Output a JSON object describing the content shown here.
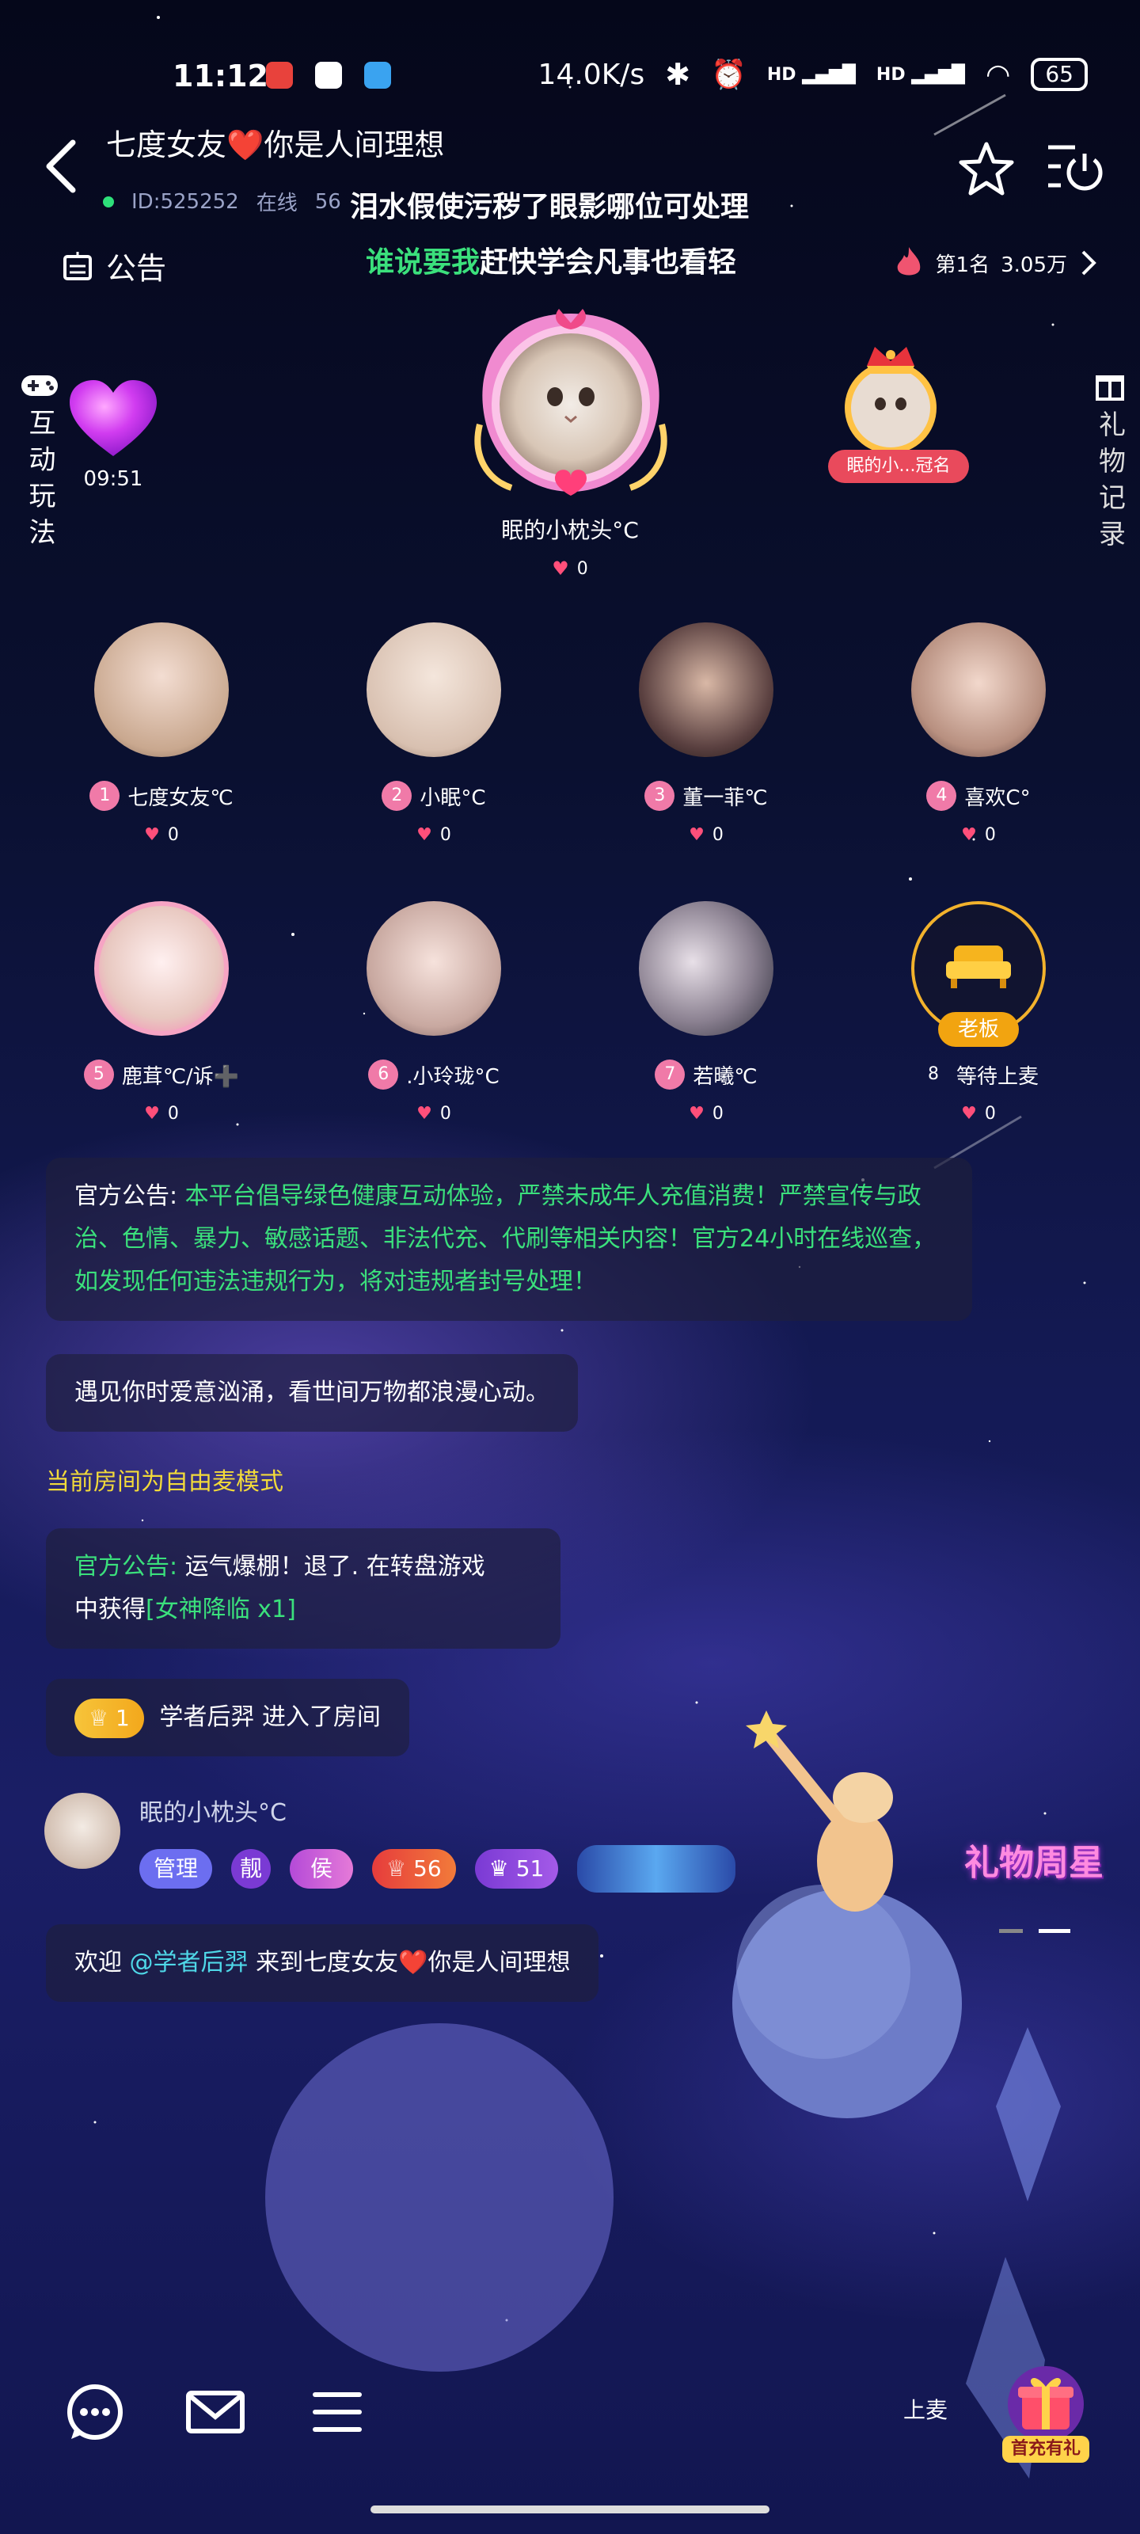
{
  "status": {
    "time": "11:12",
    "network": "14.0K/s",
    "battery": "65",
    "signal_1": "HD",
    "signal_2": "HD"
  },
  "header": {
    "title": "七度女友❤️你是人间理想",
    "room_id": "ID:525252",
    "online_label": "在线",
    "online_count": "56"
  },
  "marquee": {
    "line1": "泪水假使污秽了眼影哪位可处理",
    "line2_green": "谁说要我",
    "line2_rest": "赶快学会凡事也看轻"
  },
  "notice_label": "公告",
  "rank": {
    "label": "第1名",
    "value": "3.05万"
  },
  "side": {
    "play_label": "互动玩法",
    "gift_label": "礼物记录",
    "timer": "09:51"
  },
  "host": {
    "name": "眠的小枕头°C",
    "likes": "0",
    "crown_badge": "眠的小...冠名"
  },
  "seats": [
    {
      "num": "1",
      "name": "七度女友℃",
      "likes": "0",
      "color": "#c9a88f"
    },
    {
      "num": "2",
      "name": "小眠°C",
      "likes": "0",
      "color": "#d8c0b0"
    },
    {
      "num": "3",
      "name": "董一菲℃",
      "likes": "0",
      "color": "#3a2a2a"
    },
    {
      "num": "4",
      "name": "喜欢C°",
      "likes": "0",
      "color": "#b89080"
    },
    {
      "num": "5",
      "name": "鹿茸℃/诉➕",
      "likes": "0",
      "color": "#e8c8c0"
    },
    {
      "num": "6",
      "name": ".小玲珑°C",
      "likes": "0",
      "color": "#c8a8a0"
    },
    {
      "num": "7",
      "name": "若曦℃",
      "likes": "0",
      "color": "#4a4a58"
    },
    {
      "num": "8",
      "name": "等待上麦",
      "likes": "0",
      "badge": "老板"
    }
  ],
  "chat": {
    "official_label": "官方公告:",
    "official_text": "本平台倡导绿色健康互动体验，严禁未成年人充值消费！严禁宣传与政治、色情、暴力、敏感话题、非法代充、代刷等相关内容！官方24小时在线巡查，如发现任何违法违规行为，将对违规者封号处理！",
    "welcome_msg": "遇见你时爱意汹涌，看世间万物都浪漫心动。",
    "mode_msg": "当前房间为自由麦模式",
    "luck_label": "官方公告:",
    "luck_text_1": "运气爆棚！退了. 在转盘游戏",
    "luck_text_2": "中获得",
    "luck_prize": "[女神降临 x1]",
    "join_level": "1",
    "join_user": "学者后羿",
    "join_text": "进入了房间",
    "host_user": "眠的小枕头°C",
    "host_badges": {
      "admin": "管理",
      "pretty": "靓",
      "rank": "侯",
      "level1": "56",
      "level2": "51"
    },
    "greet_prefix": "欢迎",
    "greet_user": "@学者后羿",
    "greet_suffix": "来到七度女友❤️你是人间理想"
  },
  "promo": {
    "gift_week": "礼物周星",
    "first_charge": "首充有礼"
  },
  "bottom": {
    "up_mic": "上麦"
  }
}
